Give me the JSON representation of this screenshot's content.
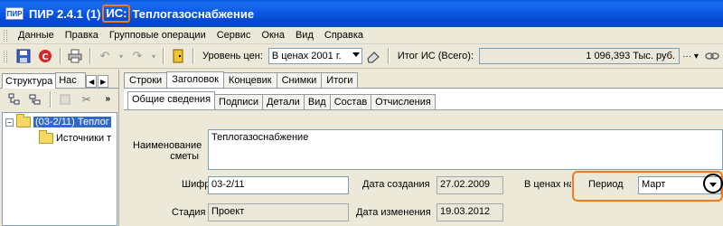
{
  "titlebar": {
    "app_icon_text": "ПИР",
    "app_name": "ПИР 2.4.1",
    "doc_index": "(1)",
    "highlight": "ИС:",
    "doc_name": "Теплогазоснабжение"
  },
  "menu": [
    "Данные",
    "Правка",
    "Групповые операции",
    "Сервис",
    "Окна",
    "Вид",
    "Справка"
  ],
  "toolbar": {
    "price_level_label": "Уровень цен:",
    "price_level_value": "В ценах 2001 г.",
    "total_label": "Итог ИС (Всего):",
    "total_value": "1 096,393 Тыс. руб."
  },
  "left_panel": {
    "tabs": [
      "Структура",
      "Нас"
    ],
    "tree": [
      {
        "label": "(03-2/11) Теплог",
        "selected": true
      },
      {
        "label": "Источники т",
        "selected": false
      }
    ]
  },
  "tabs_level1": [
    "Строки",
    "Заголовок",
    "Концевик",
    "Снимки",
    "Итоги"
  ],
  "tabs_level1_active": "Заголовок",
  "tabs_level2": [
    "Общие сведения",
    "Подписи",
    "Детали",
    "Вид",
    "Состав",
    "Отчисления"
  ],
  "tabs_level2_active": "Общие сведения",
  "form": {
    "name_label_1": "Наименование",
    "name_label_2": "сметы",
    "name_value": "Теплогазоснабжение",
    "code_label": "Шифр",
    "code_value": "03-2/11",
    "created_label": "Дата создания",
    "created_value": "27.02.2009",
    "in_prices_label": "В ценах на",
    "period_label": "Период",
    "period_value": "Март",
    "stage_label": "Стадия",
    "stage_value": "Проект",
    "changed_label": "Дата изменения",
    "changed_value": "19.03.2012"
  },
  "colors": {
    "titlebar": "#0a4bc2",
    "highlight": "#f07a1f",
    "selection": "#316ac5"
  }
}
